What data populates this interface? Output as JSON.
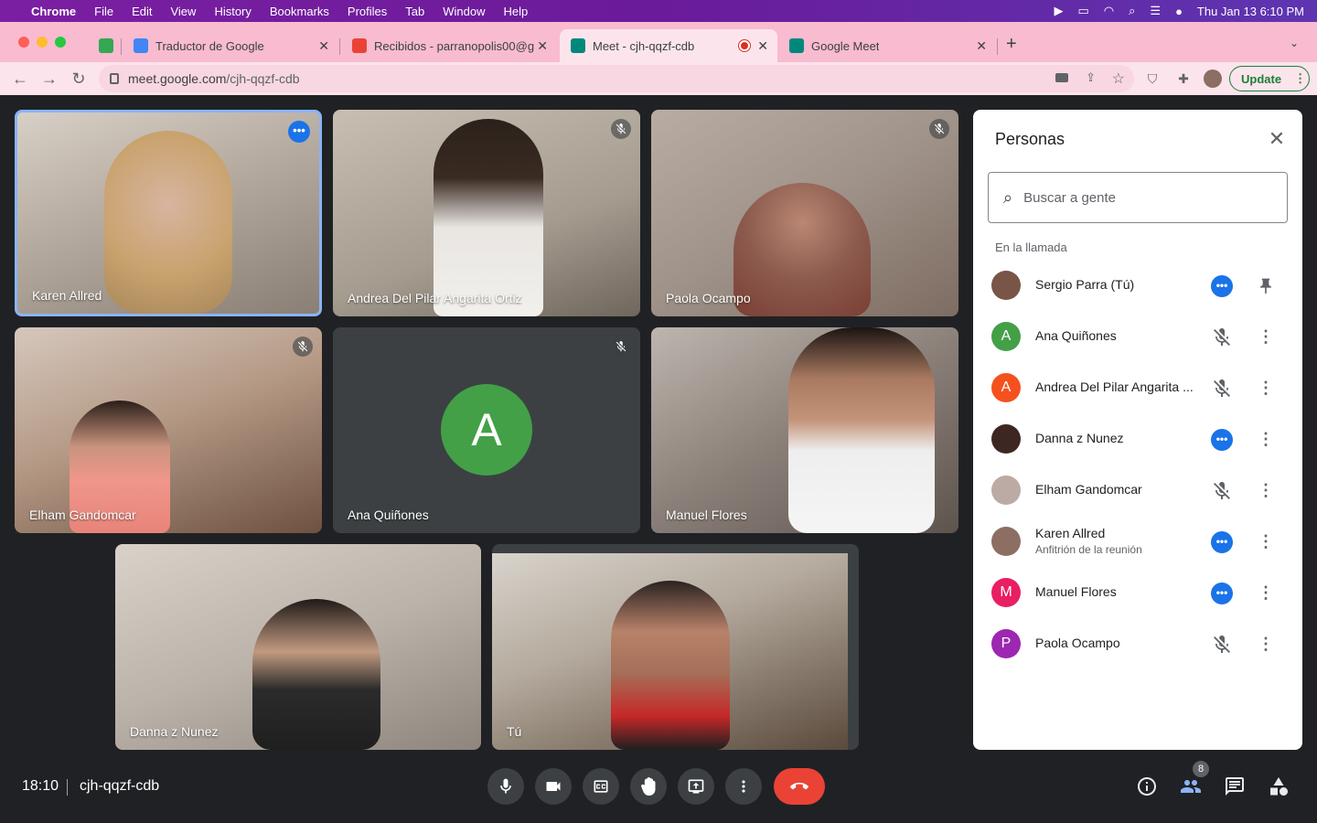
{
  "menubar": {
    "app": "Chrome",
    "items": [
      "File",
      "Edit",
      "View",
      "History",
      "Bookmarks",
      "Profiles",
      "Tab",
      "Window",
      "Help"
    ],
    "clock": "Thu Jan 13  6:10 PM"
  },
  "tabs": [
    {
      "title": "",
      "icon": "sheets-icon"
    },
    {
      "title": "Traductor de Google",
      "icon": "google-translate-icon"
    },
    {
      "title": "Recibidos - parranopolis00@g",
      "icon": "gmail-icon"
    },
    {
      "title": "Meet - cjh-qqzf-cdb",
      "icon": "meet-icon",
      "active": true,
      "recording": true
    },
    {
      "title": "Google Meet",
      "icon": "meet-icon"
    }
  ],
  "address_bar": {
    "host": "meet.google.com",
    "path": "/cjh-qqzf-cdb",
    "update_label": "Update"
  },
  "tiles": {
    "karen": {
      "name": "Karen Allred"
    },
    "andrea": {
      "name": "Andrea Del Pilar Angarita Ortiz"
    },
    "paola": {
      "name": "Paola Ocampo"
    },
    "elham": {
      "name": "Elham Gandomcar"
    },
    "ana": {
      "name": "Ana Quiñones",
      "initial": "A"
    },
    "manuel": {
      "name": "Manuel Flores"
    },
    "danna": {
      "name": "Danna z Nunez"
    },
    "self": {
      "name": "Tú"
    }
  },
  "panel": {
    "title": "Personas",
    "search_placeholder": "Buscar a gente",
    "section_label": "En la llamada",
    "people": [
      {
        "name": "Sergio Parra (Tú)",
        "initial": "",
        "color": "#795548",
        "status": "speaking"
      },
      {
        "name": "Ana Quiñones",
        "initial": "A",
        "color": "#43a047",
        "status": "muted"
      },
      {
        "name": "Andrea Del Pilar Angarita ...",
        "initial": "A",
        "color": "#f4511e",
        "status": "muted"
      },
      {
        "name": "Danna z Nunez",
        "initial": "",
        "color": "#3e2723",
        "status": "speaking"
      },
      {
        "name": "Elham Gandomcar",
        "initial": "",
        "color": "#bcaaa4",
        "status": "muted"
      },
      {
        "name": "Karen Allred",
        "subtitle": "Anfitrión de la reunión",
        "initial": "",
        "color": "#8d6e63",
        "status": "speaking"
      },
      {
        "name": "Manuel Flores",
        "initial": "M",
        "color": "#e91e63",
        "status": "speaking"
      },
      {
        "name": "Paola Ocampo",
        "initial": "P",
        "color": "#9c27b0",
        "status": "muted"
      }
    ]
  },
  "bottombar": {
    "time": "18:10",
    "meeting_code": "cjh-qqzf-cdb",
    "people_count": "8"
  }
}
